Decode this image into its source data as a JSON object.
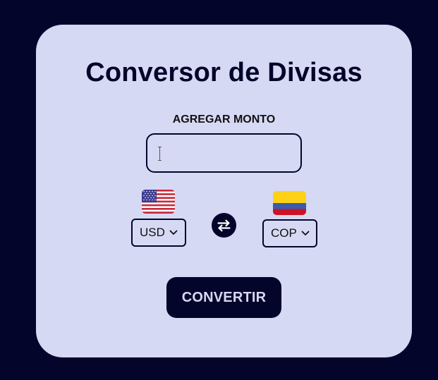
{
  "converter": {
    "title": "Conversor de Divisas",
    "amount_label": "AGREGAR MONTO",
    "amount_value": "",
    "from_currency": "USD",
    "to_currency": "COP",
    "from_flag": "us-flag-icon",
    "to_flag": "colombia-flag-icon",
    "swap_icon": "swap-arrows-icon",
    "convert_label": "CONVERTIR"
  },
  "colors": {
    "background": "#03052a",
    "card": "#d6d9f3",
    "accent": "#03052a"
  }
}
